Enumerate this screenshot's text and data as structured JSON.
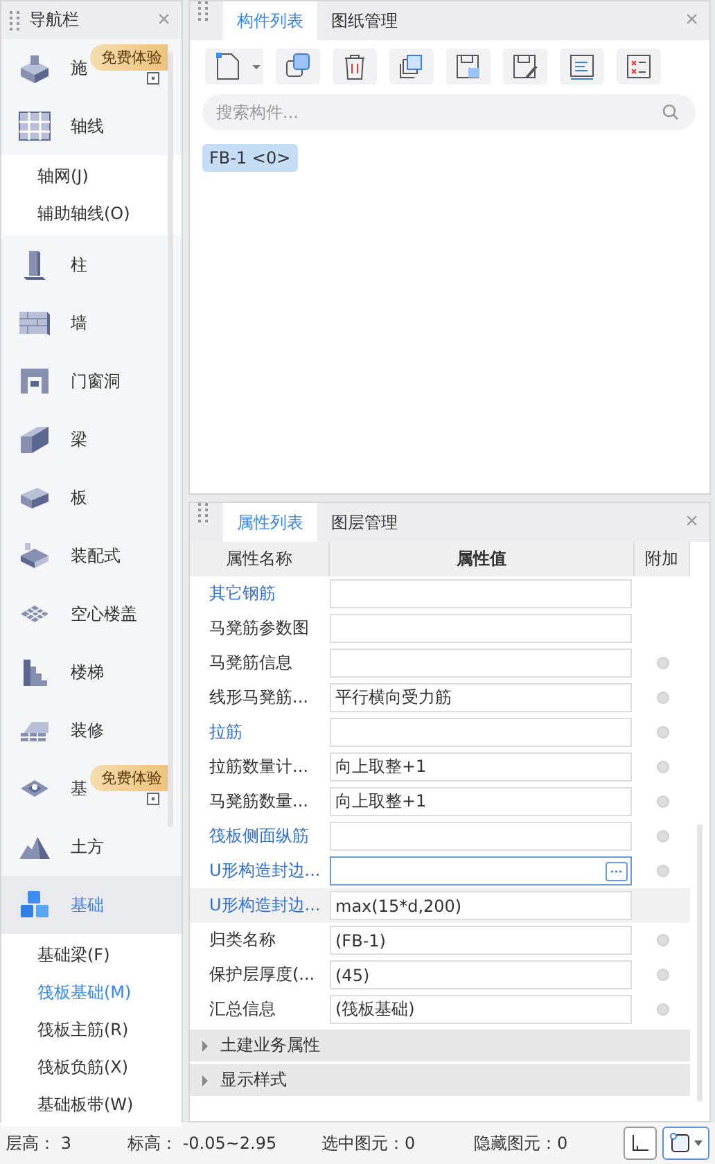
{
  "nav": {
    "title": "导航栏",
    "close": "×",
    "items": [
      {
        "label": "施",
        "selected": false,
        "badge": "免费体验"
      },
      {
        "label": "轴线",
        "selected": false,
        "children": [
          {
            "label": "轴网(J)",
            "selected": false
          },
          {
            "label": "辅助轴线(O)",
            "selected": false
          }
        ]
      },
      {
        "label": "柱",
        "selected": false
      },
      {
        "label": "墙",
        "selected": false
      },
      {
        "label": "门窗洞",
        "selected": false
      },
      {
        "label": "梁",
        "selected": false
      },
      {
        "label": "板",
        "selected": false
      },
      {
        "label": "装配式",
        "selected": false
      },
      {
        "label": "空心楼盖",
        "selected": false
      },
      {
        "label": "楼梯",
        "selected": false
      },
      {
        "label": "装修",
        "selected": false
      },
      {
        "label": "基",
        "selected": false,
        "badge": "免费体验"
      },
      {
        "label": "土方",
        "selected": false
      },
      {
        "label": "基础",
        "selected": true,
        "children": [
          {
            "label": "基础梁(F)",
            "selected": false
          },
          {
            "label": "筏板基础(M)",
            "selected": true
          },
          {
            "label": "筏板主筋(R)",
            "selected": false
          },
          {
            "label": "筏板负筋(X)",
            "selected": false
          },
          {
            "label": "基础板带(W)",
            "selected": false
          }
        ]
      }
    ]
  },
  "component_panel": {
    "tabs": [
      {
        "label": "构件列表",
        "selected": true
      },
      {
        "label": "图纸管理",
        "selected": false
      }
    ],
    "close": "×",
    "search": {
      "placeholder": "搜索构件..."
    },
    "components": [
      {
        "label": "FB-1 <0>",
        "selected": true
      }
    ]
  },
  "property_panel": {
    "tabs": [
      {
        "label": "属性列表",
        "selected": true
      },
      {
        "label": "图层管理",
        "selected": false
      }
    ],
    "close": "×",
    "columns": [
      "属性名称",
      "属性值",
      "附加"
    ],
    "rows": [
      {
        "name": "其它钢筋",
        "color": "#2f6fd6",
        "value": "",
        "attach": false,
        "selected": false,
        "focused": false
      },
      {
        "name": "马凳筋参数图",
        "color": "#333333",
        "value": "",
        "attach": false,
        "selected": false,
        "focused": false
      },
      {
        "name": "马凳筋信息",
        "color": "#333333",
        "value": "",
        "attach": true,
        "selected": false,
        "focused": false
      },
      {
        "name": "线形马凳筋...",
        "color": "#333333",
        "value": "平行横向受力筋",
        "attach": true,
        "selected": false,
        "focused": false
      },
      {
        "name": "拉筋",
        "color": "#2f6fd6",
        "value": "",
        "attach": true,
        "selected": false,
        "focused": false
      },
      {
        "name": "拉筋数量计...",
        "color": "#333333",
        "value": "向上取整+1",
        "attach": true,
        "selected": false,
        "focused": false
      },
      {
        "name": "马凳筋数量...",
        "color": "#333333",
        "value": "向上取整+1",
        "attach": true,
        "selected": false,
        "focused": false
      },
      {
        "name": "筏板侧面纵筋",
        "color": "#2f6fd6",
        "value": "",
        "attach": true,
        "selected": false,
        "focused": false
      },
      {
        "name": "U形构造封边...",
        "color": "#2f6fd6",
        "value": "",
        "attach": true,
        "selected": false,
        "focused": true,
        "button": "···"
      },
      {
        "name": "U形构造封边...",
        "color": "#2f6fd6",
        "value": "max(15*d,200)",
        "attach": false,
        "selected": true,
        "focused": false
      },
      {
        "name": "归类名称",
        "color": "#333333",
        "value": "(FB-1)",
        "attach": true,
        "selected": false,
        "focused": false
      },
      {
        "name": "保护层厚度(...",
        "color": "#333333",
        "value": "(45)",
        "attach": true,
        "selected": false,
        "focused": false
      },
      {
        "name": "汇总信息",
        "color": "#333333",
        "value": "(筏板基础)",
        "attach": true,
        "selected": false,
        "focused": false
      }
    ],
    "sections": [
      {
        "label": "土建业务属性",
        "expanded": false
      },
      {
        "label": "显示样式",
        "expanded": false
      }
    ]
  },
  "status_bar": {
    "items": [
      "层高： 3",
      "标高： -0.05~2.95",
      "选中图元：0",
      "隐藏图元：0"
    ],
    "view_buttons": [
      {
        "selected": false
      },
      {
        "selected": true
      }
    ]
  }
}
